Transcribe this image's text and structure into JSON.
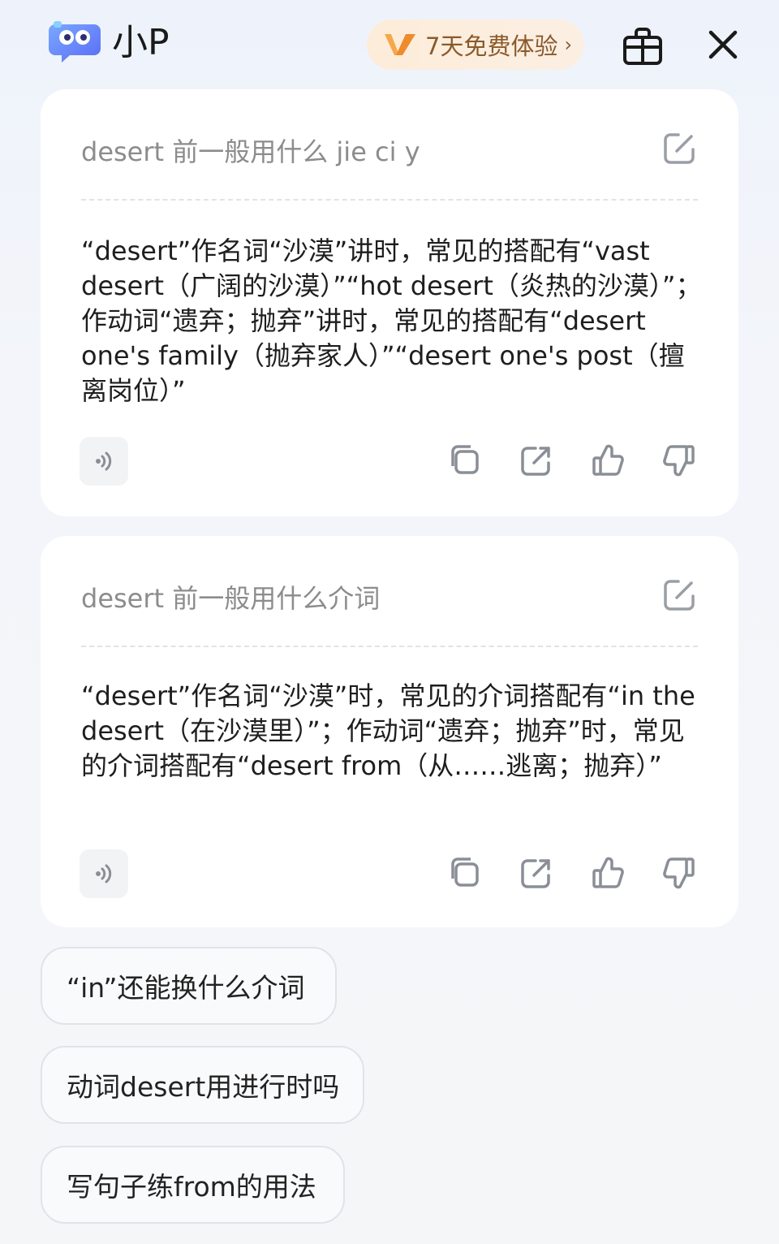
{
  "header": {
    "app_title": "小P",
    "trial_label": "7天免费体验",
    "trial_chevron": "›",
    "icons": [
      "robot-logo-icon",
      "gift-icon",
      "close-icon"
    ]
  },
  "conversations": [
    {
      "query": "desert 前一般用什么 jie ci y",
      "answer": "“desert”作名词“沙漠”讲时，常见的搭配有“vast desert（广阔的沙漠）”“hot desert（炎热的沙漠）”；作动词“遗弃；抛弃”讲时，常见的搭配有“desert one's family（抛弃家人）”“desert one's post（擅离岗位）”"
    },
    {
      "query": "desert 前一般用什么介词",
      "answer": "“desert”作名词“沙漠”时，常见的介词搭配有“in the desert（在沙漠里）”；作动词“遗弃；抛弃”时，常见的介词搭配有“desert from（从……逃离；抛弃）”"
    }
  ],
  "suggestions": [
    "“in”还能换什么介词",
    "动词desert用进行时吗",
    "写句子练from的用法"
  ],
  "colors": {
    "accent_orange": "#f0a040",
    "trial_text": "#8a5a2b",
    "icon_gray": "#9a9ea6"
  }
}
